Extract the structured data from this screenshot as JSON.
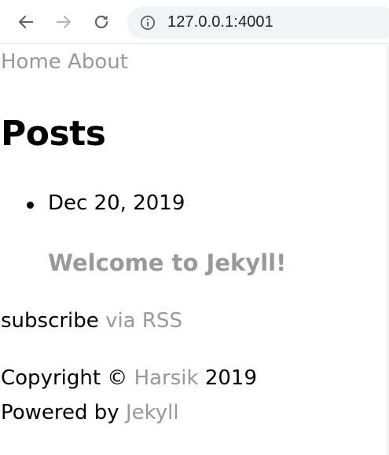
{
  "browser": {
    "url": "127.0.0.1:4001",
    "icons": {
      "back": "arrow-left-icon",
      "forward": "arrow-right-icon",
      "reload": "reload-icon",
      "site_info": "info-icon"
    }
  },
  "nav": {
    "items": [
      {
        "label": "Home"
      },
      {
        "label": "About"
      }
    ]
  },
  "main": {
    "title": "Posts",
    "posts": [
      {
        "date": "Dec 20, 2019",
        "title": "Welcome to Jekyll!"
      }
    ]
  },
  "subscribe": {
    "prefix": "subscribe",
    "link": "via RSS"
  },
  "footer": {
    "copyright_prefix": "Copyright ©",
    "author": "Harsik",
    "year": "2019",
    "powered_prefix": "Powered by",
    "powered_link": "Jekyll"
  },
  "colors": {
    "link": "#999999",
    "text": "#000000",
    "omnibox_bg": "#f1f3f4"
  }
}
